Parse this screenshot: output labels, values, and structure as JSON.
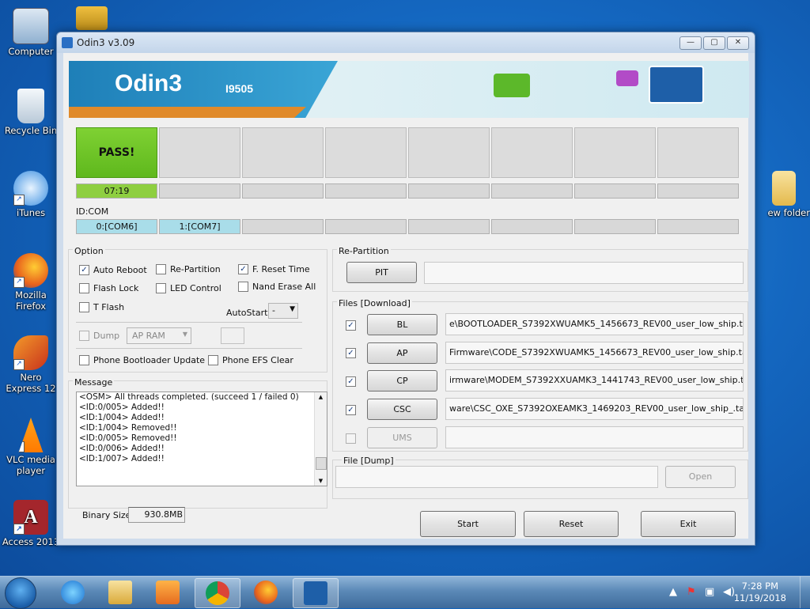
{
  "desktop": {
    "icons": [
      {
        "label": "Computer"
      },
      {
        "label": "Recycle Bin"
      },
      {
        "label": "iTunes"
      },
      {
        "label": "Mozilla Firefox"
      },
      {
        "label": "Nero Express 12"
      },
      {
        "label": "VLC media player"
      },
      {
        "label": "Access 2013"
      },
      {
        "label": "ew folder"
      }
    ]
  },
  "window": {
    "title": "Odin3 v3.09",
    "controls": {
      "minimize": "—",
      "maximize": "▢",
      "close": "✕"
    }
  },
  "banner": {
    "app_name": "Odin3",
    "model": "I9505"
  },
  "slots": {
    "statuses": [
      "PASS!",
      "",
      "",
      "",
      "",
      "",
      "",
      ""
    ],
    "times": [
      "07:19",
      "",
      "",
      "",
      "",
      "",
      "",
      ""
    ],
    "id_com_label": "ID:COM",
    "ports": [
      "0:[COM6]",
      "1:[COM7]",
      "",
      "",
      "",
      "",
      "",
      ""
    ]
  },
  "option": {
    "label": "Option",
    "auto_reboot": {
      "label": "Auto Reboot",
      "checked": true
    },
    "re_partition": {
      "label": "Re-Partition",
      "checked": false
    },
    "f_reset_time": {
      "label": "F. Reset Time",
      "checked": true
    },
    "flash_lock": {
      "label": "Flash Lock",
      "checked": false
    },
    "led_control": {
      "label": "LED Control",
      "checked": false
    },
    "nand_erase_all": {
      "label": "Nand Erase All",
      "checked": false
    },
    "t_flash": {
      "label": "T Flash",
      "checked": false
    },
    "autostart_label": "AutoStart",
    "autostart_value": "-",
    "dump": {
      "label": "Dump",
      "checked": false
    },
    "dump_select": "AP RAM",
    "phone_bootloader_update": {
      "label": "Phone Bootloader Update",
      "checked": false
    },
    "phone_efs_clear": {
      "label": "Phone EFS Clear",
      "checked": false
    }
  },
  "message": {
    "label": "Message",
    "lines": [
      "<OSM> All threads completed. (succeed 1 / failed 0)",
      "<ID:0/005> Added!!",
      "<ID:1/004> Added!!",
      "<ID:1/004> Removed!!",
      "<ID:0/005> Removed!!",
      "<ID:0/006> Added!!",
      "<ID:1/007> Added!!"
    ]
  },
  "repartition": {
    "label": "Re-Partition",
    "pit_label": "PIT",
    "pit_path": ""
  },
  "files": {
    "label": "Files [Download]",
    "rows": [
      {
        "button": "BL",
        "checked": true,
        "path": "e\\BOOTLOADER_S7392XWUAMK5_1456673_REV00_user_low_ship.tar.md5"
      },
      {
        "button": "AP",
        "checked": true,
        "path": "Firmware\\CODE_S7392XWUAMK5_1456673_REV00_user_low_ship.tar.md5"
      },
      {
        "button": "CP",
        "checked": true,
        "path": "irmware\\MODEM_S7392XXUAMK3_1441743_REV00_user_low_ship.tar.md5"
      },
      {
        "button": "CSC",
        "checked": true,
        "path": "ware\\CSC_OXE_S7392OXEAMK3_1469203_REV00_user_low_ship_.tar.md5"
      },
      {
        "button": "UMS",
        "checked": false,
        "path": ""
      }
    ]
  },
  "file_dump": {
    "label": "File [Dump]",
    "path": "",
    "open_label": "Open"
  },
  "binary_size": {
    "label": "Binary Size",
    "value": "930.8MB"
  },
  "actions": {
    "start": "Start",
    "reset": "Reset",
    "exit": "Exit"
  },
  "taskbar": {
    "apps": [
      "Internet Explorer",
      "Windows Explorer",
      "Windows Media Player",
      "Google Chrome",
      "Mozilla Firefox",
      "Odin3"
    ],
    "time": "7:28 PM",
    "date": "11/19/2018"
  },
  "colors": {
    "pass_green": "#6cc424",
    "com_active": "#a9dde9",
    "accent_blue": "#1e7fb8"
  }
}
